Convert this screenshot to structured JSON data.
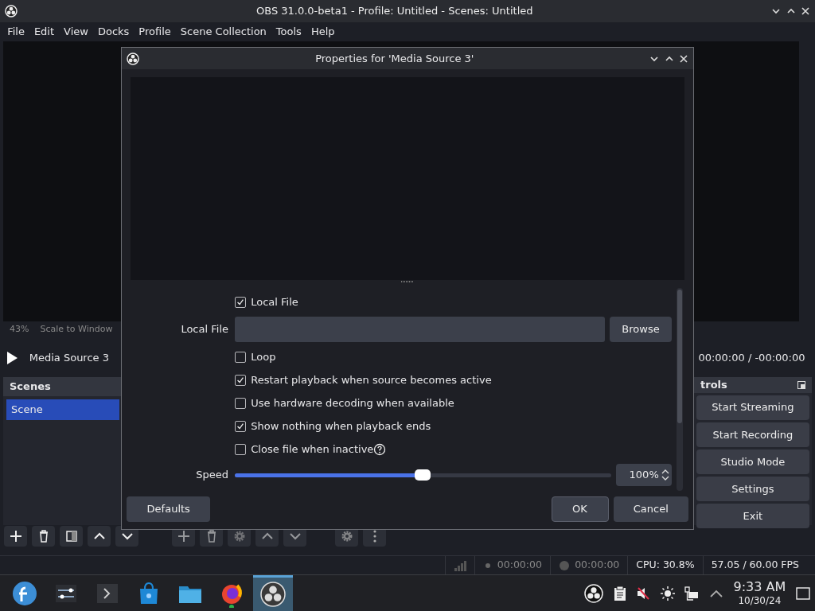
{
  "window": {
    "title": "OBS 31.0.0-beta1 - Profile: Untitled - Scenes: Untitled"
  },
  "menu": [
    "File",
    "Edit",
    "View",
    "Docks",
    "Profile",
    "Scene Collection",
    "Tools",
    "Help"
  ],
  "preview_bar": {
    "zoom": "43%",
    "scale_mode": "Scale to Window"
  },
  "media_controls": {
    "source": "Media Source 3",
    "time": "00:00:00  /  -00:00:00"
  },
  "scenes": {
    "title": "Scenes",
    "items": [
      {
        "label": "Scene",
        "selected": true
      }
    ]
  },
  "controls": {
    "title": "trols",
    "buttons": [
      "Start Streaming",
      "Start Recording",
      "Studio Mode",
      "Settings",
      "Exit"
    ]
  },
  "status_bar": {
    "stream_time": "00:00:00",
    "record_time": "00:00:00",
    "cpu": "CPU: 30.8%",
    "fps": "57.05 / 60.00 FPS"
  },
  "taskbar": {
    "apps": [
      {
        "kind": "fedora",
        "selected": false
      },
      {
        "kind": "mixer",
        "selected": false
      },
      {
        "kind": "terminal",
        "selected": false
      },
      {
        "kind": "store",
        "selected": false
      },
      {
        "kind": "folder",
        "selected": false
      },
      {
        "kind": "firefox",
        "selected": false
      },
      {
        "kind": "obs",
        "selected": true
      }
    ],
    "time": "9:33 AM",
    "date": "10/30/24"
  },
  "dialog": {
    "title": "Properties for 'Media Source 3'",
    "rows": [
      {
        "kind": "checkbox",
        "label": "Local File",
        "checked": true
      },
      {
        "kind": "file",
        "label": "Local File",
        "button": "Browse"
      },
      {
        "kind": "checkbox",
        "label": "Loop",
        "checked": false
      },
      {
        "kind": "checkbox",
        "label": "Restart playback when source becomes active",
        "checked": true
      },
      {
        "kind": "checkbox",
        "label": "Use hardware decoding when available",
        "checked": false
      },
      {
        "kind": "checkbox",
        "label": "Show nothing when playback ends",
        "checked": true
      },
      {
        "kind": "checkbox",
        "label": "Close file when inactive",
        "checked": false,
        "help": true
      },
      {
        "kind": "slider",
        "label": "Speed",
        "level": 0.5,
        "value": "100%"
      }
    ],
    "defaults": "Defaults",
    "ok": "OK",
    "cancel": "Cancel"
  }
}
